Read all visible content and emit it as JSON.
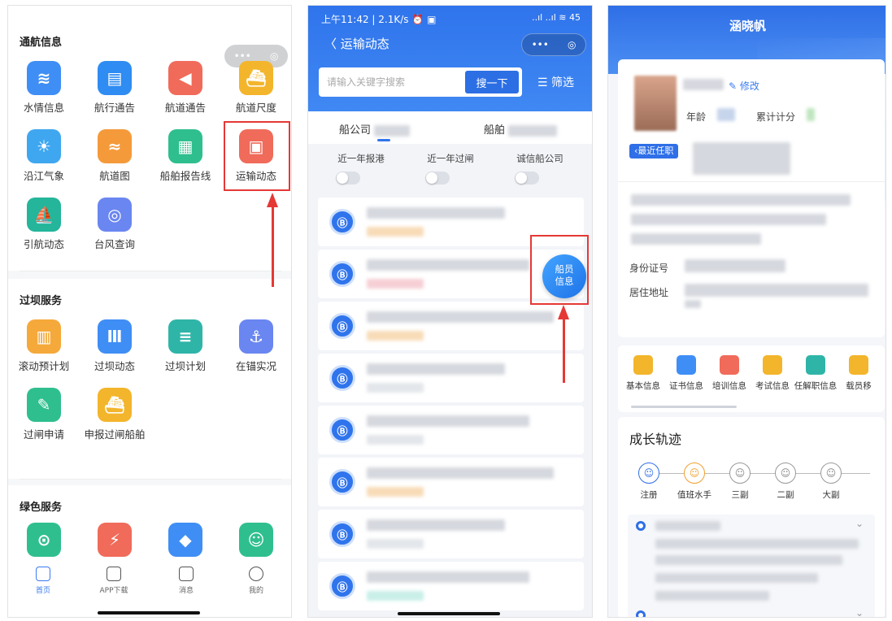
{
  "panel1": {
    "capsule_dots": "•••",
    "capsule_target": "◎",
    "sections": [
      {
        "title": "通航信息",
        "tiles": [
          {
            "label": "水情信息",
            "color": "#3f8ef5",
            "icon": "water-level-icon"
          },
          {
            "label": "航行通告",
            "color": "#2f8cf2",
            "icon": "notice-board-icon"
          },
          {
            "label": "航道通告",
            "color": "#f06b5a",
            "icon": "megaphone-icon"
          },
          {
            "label": "航道尺度",
            "color": "#f3b52c",
            "icon": "ship-dimension-icon"
          },
          {
            "label": "沿江气象",
            "color": "#3fa7f0",
            "icon": "weather-icon"
          },
          {
            "label": "航道图",
            "color": "#f59a3a",
            "icon": "channel-map-icon"
          },
          {
            "label": "船舶报告线",
            "color": "#2fbf8f",
            "icon": "report-line-icon"
          },
          {
            "label": "运输动态",
            "color": "#f06b5a",
            "icon": "transport-status-icon"
          },
          {
            "label": "引航动态",
            "color": "#24b59a",
            "icon": "pilot-ship-icon"
          },
          {
            "label": "台风查询",
            "color": "#6a86f0",
            "icon": "typhoon-icon"
          }
        ]
      },
      {
        "title": "过坝服务",
        "tiles": [
          {
            "label": "滚动预计划",
            "color": "#f5a93a",
            "icon": "calendar-icon"
          },
          {
            "label": "过坝动态",
            "color": "#3f8ef5",
            "icon": "dam-icon"
          },
          {
            "label": "过坝计划",
            "color": "#2fb5a8",
            "icon": "dam-plan-icon"
          },
          {
            "label": "在锚实况",
            "color": "#6a86f0",
            "icon": "anchor-icon"
          },
          {
            "label": "过闸申请",
            "color": "#2fbf8f",
            "icon": "edit-form-icon"
          },
          {
            "label": "申报过闸船舶",
            "color": "#f3b52c",
            "icon": "ship-declare-icon"
          }
        ]
      },
      {
        "title": "绿色服务",
        "tiles": [
          {
            "label": "",
            "color": "#2fbf8f",
            "icon": "pin-icon"
          },
          {
            "label": "",
            "color": "#f06b5a",
            "icon": "shore-power-icon"
          },
          {
            "label": "",
            "color": "#3f8ef5",
            "icon": "water-drop-icon"
          },
          {
            "label": "",
            "color": "#2fbf8f",
            "icon": "service-person-icon"
          }
        ]
      }
    ],
    "tabbar": [
      {
        "label": "首页",
        "icon": "home-icon",
        "active": true
      },
      {
        "label": "APP下载",
        "icon": "download-icon",
        "active": false
      },
      {
        "label": "消息",
        "icon": "message-icon",
        "active": false
      },
      {
        "label": "我的",
        "icon": "profile-icon",
        "active": false
      }
    ]
  },
  "panel2": {
    "status_time": "上午11:42 | 2.1K/s ⏰ ▣",
    "status_right": "..ıl ..ıl ≋ 45",
    "nav_back": "〈",
    "nav_title": "运输动态",
    "capsule_dots": "•••",
    "capsule_target": "◎",
    "search_placeholder": "请输入关键字搜索",
    "search_button": "搜一下",
    "filter_icon": "☰",
    "filter_label": "筛选",
    "tab_company": "船公司",
    "tab_ship": "船舶",
    "toggles": [
      "近一年报港",
      "近一年过闸",
      "诚信船公司"
    ],
    "card_icon_glyph": "Ⓑ",
    "fab_line1": "船员",
    "fab_line2": "信息"
  },
  "panel3": {
    "title": "涵晓帆",
    "modify_label": "修改",
    "age_label": "年龄",
    "score_label": "累计计分",
    "recent_label": "‹最近任职",
    "id_label": "身份证号",
    "address_label": "居住地址",
    "quick_items": [
      {
        "label": "基本信息",
        "color": "#f3b52c",
        "icon": "basic-info-icon"
      },
      {
        "label": "证书信息",
        "color": "#3f8ef5",
        "icon": "certificate-icon"
      },
      {
        "label": "培训信息",
        "color": "#f06b5a",
        "icon": "training-icon"
      },
      {
        "label": "考试信息",
        "color": "#f3b52c",
        "icon": "exam-icon"
      },
      {
        "label": "任解职信息",
        "color": "#2fb5a8",
        "icon": "job-icon"
      },
      {
        "label": "载员移",
        "color": "#f3b52c",
        "icon": "shield-icon"
      }
    ],
    "growth_title": "成长轨迹",
    "steps": [
      {
        "label": "注册",
        "state": "done"
      },
      {
        "label": "值班水手",
        "state": "cur"
      },
      {
        "label": "三副",
        "state": "todo"
      },
      {
        "label": "二副",
        "state": "todo"
      },
      {
        "label": "大副",
        "state": "todo"
      }
    ]
  }
}
